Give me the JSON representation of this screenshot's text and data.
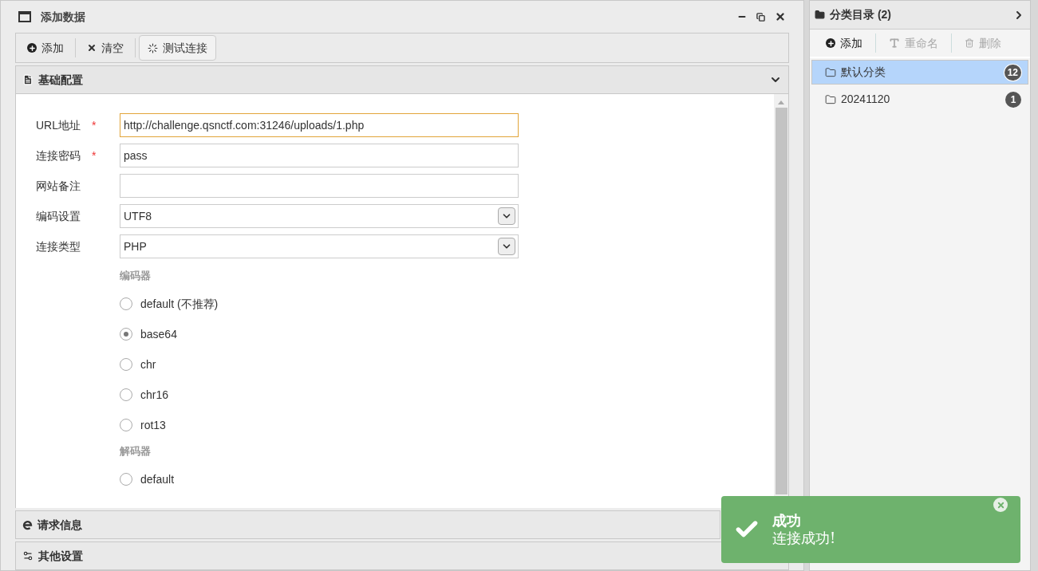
{
  "window": {
    "title": "添加数据"
  },
  "toolbar": [
    {
      "label": "添加"
    },
    {
      "label": "清空"
    },
    {
      "label": "测试连接"
    }
  ],
  "sections": [
    {
      "title": "基础配置",
      "expanded": true
    },
    {
      "title": "请求信息",
      "expanded": false
    },
    {
      "title": "其他设置",
      "expanded": false
    }
  ],
  "form": {
    "fields": [
      {
        "kind": "text",
        "label": "URL地址",
        "required_mark": "*",
        "value": "http://challenge.qsnctf.com:31246/uploads/1.php",
        "focused": true
      },
      {
        "kind": "text",
        "label": "连接密码",
        "required_mark": "*",
        "value": "pass",
        "focused": false
      },
      {
        "kind": "text",
        "label": "网站备注",
        "focused": false
      },
      {
        "kind": "select",
        "label": "编码设置",
        "value": "UTF8"
      },
      {
        "kind": "select",
        "label": "连接类型",
        "value": "PHP"
      }
    ],
    "groups": [
      {
        "title": "编码器",
        "options": [
          {
            "label": "default (不推荐)",
            "selected": false
          },
          {
            "label": "base64",
            "selected": true
          },
          {
            "label": "chr",
            "selected": false
          },
          {
            "label": "chr16",
            "selected": false
          },
          {
            "label": "rot13",
            "selected": false
          }
        ]
      },
      {
        "title": "解码器",
        "options": [
          {
            "label": "default",
            "selected": false
          }
        ]
      }
    ]
  },
  "sidebar": {
    "title": "分类目录 (2)",
    "actions": [
      {
        "label": "添加",
        "disabled": false
      },
      {
        "label": "重命名",
        "disabled": true
      },
      {
        "label": "删除",
        "disabled": true
      }
    ],
    "items": [
      {
        "name": "默认分类",
        "count": "12",
        "selected": true
      },
      {
        "name": "20241120",
        "count": "1",
        "selected": false
      }
    ]
  },
  "toast": {
    "title": "成功",
    "message": "连接成功!"
  }
}
